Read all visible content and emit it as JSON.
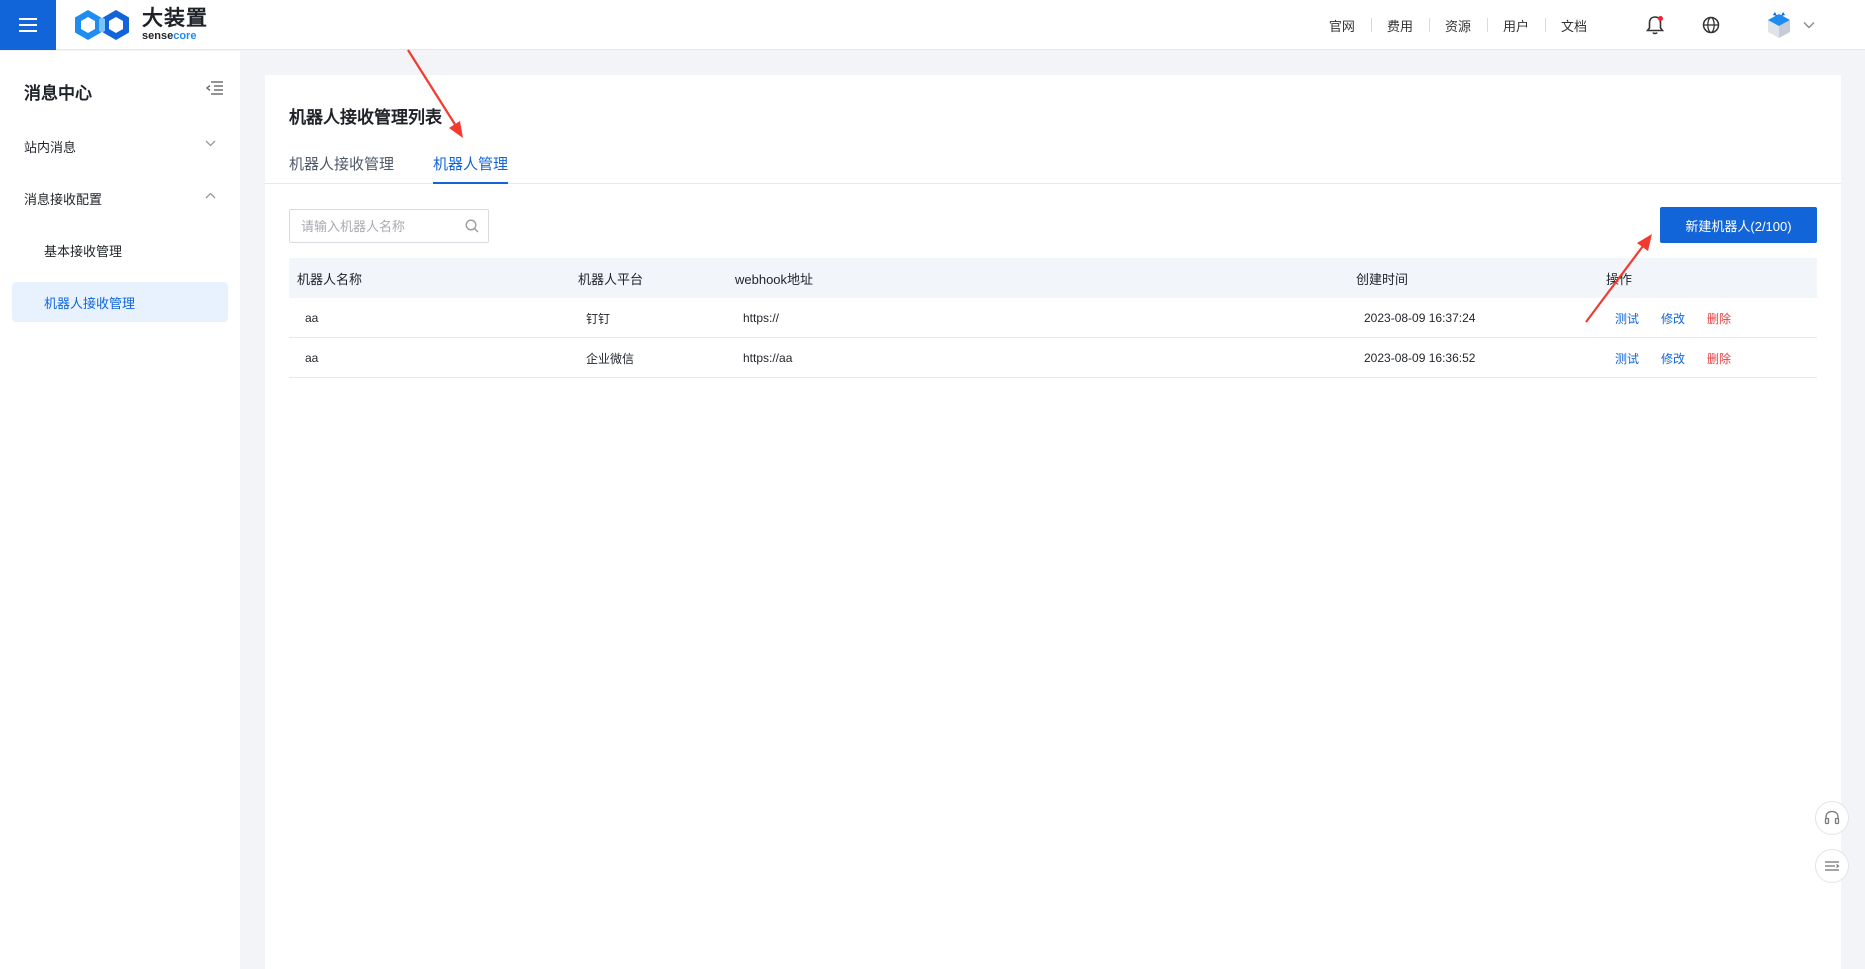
{
  "header": {
    "logo_cn": "大装置",
    "logo_en_1": "sense",
    "logo_en_2": "core",
    "nav": [
      "官网",
      "费用",
      "资源",
      "用户",
      "文档"
    ],
    "icons": [
      "menu-icon",
      "bell-icon",
      "globe-icon",
      "avatar-icon",
      "chevron-down-icon"
    ],
    "notification_dot_color": "#f5222d"
  },
  "sidebar": {
    "title": "消息中心",
    "items": [
      {
        "label": "站内消息",
        "expanded": false
      },
      {
        "label": "消息接收配置",
        "expanded": true
      },
      {
        "label": "基本接收管理"
      },
      {
        "label": "机器人接收管理",
        "active": true
      }
    ]
  },
  "main": {
    "title": "机器人接收管理列表",
    "tabs": [
      {
        "label": "机器人接收管理",
        "active": false
      },
      {
        "label": "机器人管理",
        "active": true
      }
    ],
    "search": {
      "placeholder": "请输入机器人名称",
      "value": ""
    },
    "new_button": "新建机器人(2/100)",
    "table": {
      "columns": [
        "机器人名称",
        "机器人平台",
        "webhook地址",
        "创建时间",
        "操作"
      ],
      "rows": [
        {
          "name": "aa",
          "platform": "钉钉",
          "webhook": "https://",
          "created": "2023-08-09 16:37:24"
        },
        {
          "name": "aa",
          "platform": "企业微信",
          "webhook": "https://aa",
          "created": "2023-08-09 16:36:52"
        }
      ],
      "actions": {
        "test": "测试",
        "edit": "修改",
        "delete": "删除"
      }
    }
  },
  "float_buttons": [
    "headset-icon",
    "list-icon"
  ],
  "colors": {
    "primary": "#1165d9",
    "danger": "#e63f3f",
    "annotation": "#f23a2f"
  }
}
